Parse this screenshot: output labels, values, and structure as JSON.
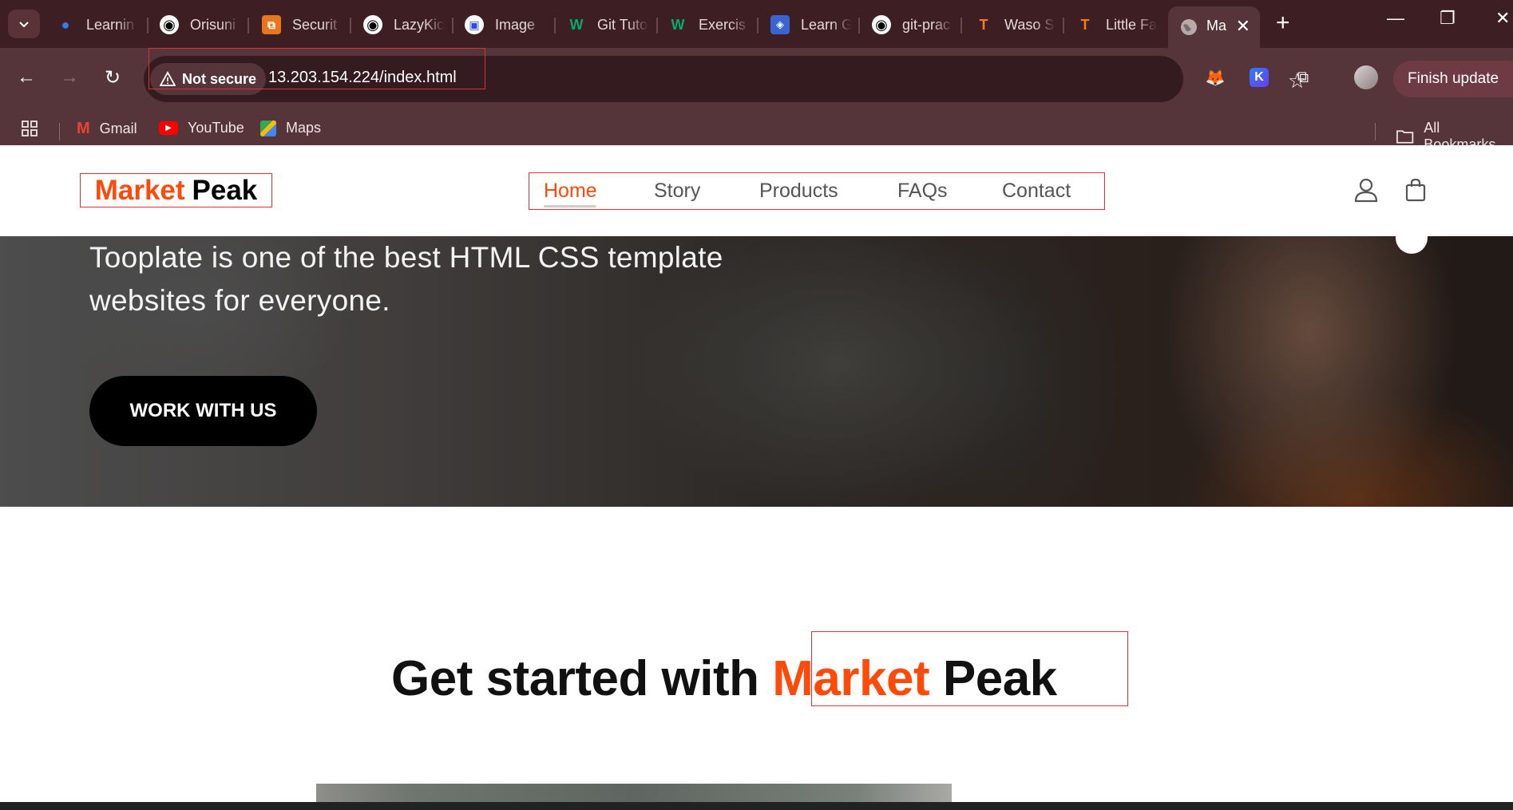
{
  "browser": {
    "tabs": [
      {
        "title": "Learnin"
      },
      {
        "title": "Orisuni"
      },
      {
        "title": "Securit"
      },
      {
        "title": "LazyKic"
      },
      {
        "title": "Image"
      },
      {
        "title": "Git Tuto"
      },
      {
        "title": "Exercis"
      },
      {
        "title": "Learn G"
      },
      {
        "title": "git-prac"
      },
      {
        "title": "Waso S"
      },
      {
        "title": "Little Fa"
      }
    ],
    "active_tab_title": "Ma",
    "security_label": "Not secure",
    "url": "13.203.154.224/index.html",
    "update_button": "Finish update",
    "bookmarks": [
      "Gmail",
      "YouTube",
      "Maps"
    ],
    "all_bookmarks": "All Bookmarks",
    "accent": "#ff4a0a"
  },
  "site": {
    "logo_part1": "Market",
    "logo_part2": "Peak",
    "nav": [
      "Home",
      "Story",
      "Products",
      "FAQs",
      "Contact"
    ],
    "hero_text_line1": "Tooplate is one of the best HTML CSS template",
    "hero_text_line2": "websites for everyone.",
    "hero_button": "WORK WITH US",
    "section_title_prefix": "Get started with",
    "section_title_brand": "Market",
    "section_title_peak": "Peak"
  }
}
